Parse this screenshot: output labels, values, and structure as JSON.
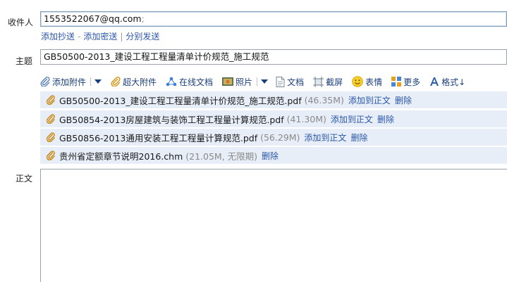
{
  "recipient": {
    "label": "收件人",
    "value": "1553522067@qq.com",
    "trailing": ";"
  },
  "recipient_links": {
    "add_cc": "添加抄送",
    "dash": "-",
    "add_bcc": "添加密送",
    "pipe": "|",
    "separate_send": "分别发送"
  },
  "subject": {
    "label": "主题",
    "value": "GB50500-2013_建设工程工程量清单计价规范_施工规范"
  },
  "toolbar": {
    "add_attachment": "添加附件",
    "big_attachment": "超大附件",
    "online_doc": "在线文档",
    "photo": "照片",
    "document": "文档",
    "screenshot": "截屏",
    "emoji": "表情",
    "more": "更多",
    "format": "格式↓"
  },
  "attachments": [
    {
      "name": "GB50500-2013_建设工程工程量清单计价规范_施工规范.pdf",
      "size": "(46.35M)",
      "add_to_body": "添加到正文",
      "delete": "删除"
    },
    {
      "name": "GB50854-2013房屋建筑与装饰工程工程量计算规范.pdf",
      "size": "(41.30M)",
      "add_to_body": "添加到正文",
      "delete": "删除"
    },
    {
      "name": "GB50856-2013通用安装工程工程量计算规范.pdf",
      "size": "(56.29M)",
      "add_to_body": "添加到正文",
      "delete": "删除"
    },
    {
      "name": "贵州省定额章节说明2016.chm",
      "size": "(21.05M, 无限期)",
      "delete": "删除"
    }
  ],
  "body_label": "正文",
  "colors": {
    "link": "#2a56a8",
    "attachment_bg": "#e7eef8",
    "toolbar_text": "#1b3f7a"
  }
}
